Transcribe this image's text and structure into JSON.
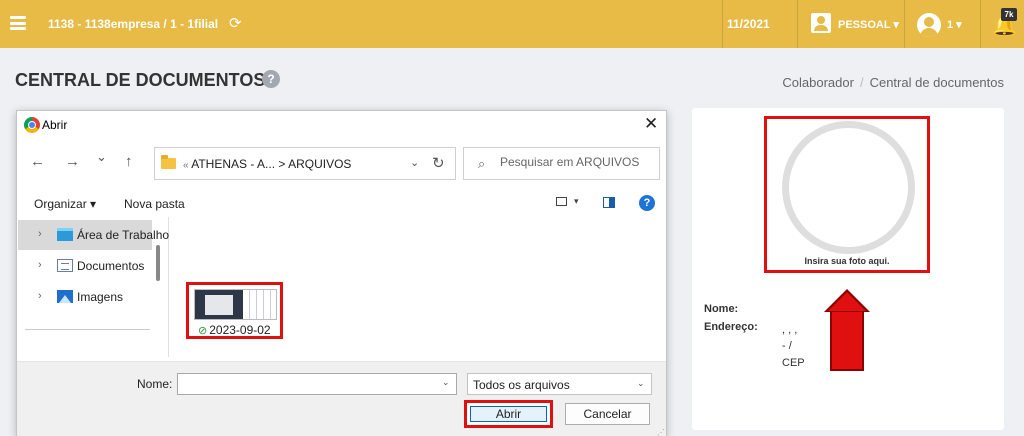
{
  "header": {
    "company": "1138 - 1138empresa / 1 - 1filial",
    "period": "11/2021",
    "pessoal_label": "PESSOAL ▾",
    "user_label": "1 ▾",
    "notification_count": "7k",
    "accent_color": "#e8bb46"
  },
  "page": {
    "title": "CENTRAL DE DOCUMENTOS",
    "help": "?",
    "breadcrumb": {
      "parent": "Colaborador",
      "separator": "/",
      "current": "Central de documentos"
    }
  },
  "profile": {
    "photo_caption": "Insira sua foto aqui.",
    "name_label": "Nome:",
    "address_label": "Endereço:",
    "address_lines": [
      ", , ,",
      "- /",
      "CEP"
    ]
  },
  "dialog": {
    "title": "Abrir",
    "close": "✕",
    "nav": {
      "back": "←",
      "forward": "→",
      "recent": "⌄",
      "up": "↑"
    },
    "path": {
      "prefix": "«",
      "segment1": "ATHENAS - A...",
      "separator": ">",
      "segment2": "ARQUIVOS",
      "dropdown": "⌄",
      "refresh": "↻"
    },
    "search_placeholder": "Pesquisar em ARQUIVOS",
    "toolbar": {
      "organizar": "Organizar ▾",
      "nova_pasta": "Nova pasta",
      "view_caret": "▾",
      "help": "?"
    },
    "nav_tree": [
      {
        "label": "Área de Trabalho",
        "icon": "desktop-folder-icon",
        "selected": true
      },
      {
        "label": "Documentos",
        "icon": "documents-icon",
        "selected": false
      },
      {
        "label": "Imagens",
        "icon": "images-icon",
        "selected": false
      }
    ],
    "file": {
      "name": "2023-09-02",
      "check": "⊘"
    },
    "footer": {
      "name_label": "Nome:",
      "name_value": "",
      "file_type": "Todos os arquivos",
      "open_button": "Abrir",
      "cancel_button": "Cancelar"
    }
  },
  "highlight_color": "#e01010"
}
